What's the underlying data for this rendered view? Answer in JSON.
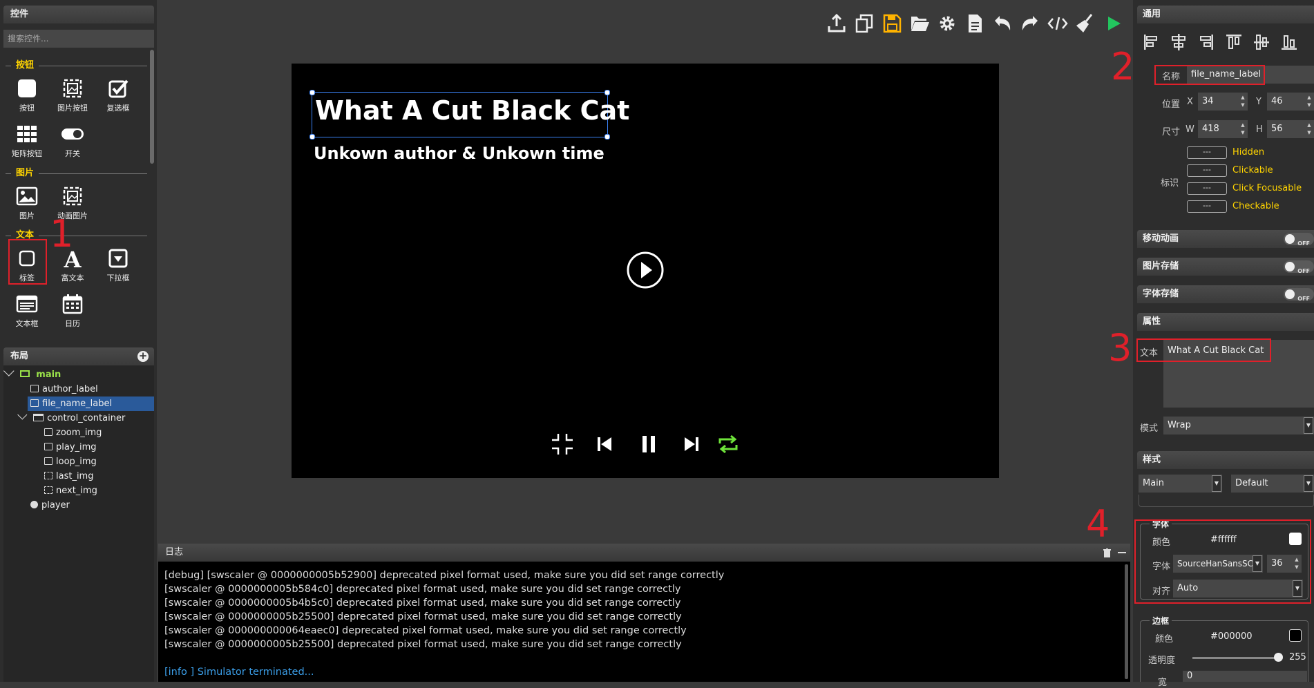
{
  "left_panel": {
    "title": "控件",
    "search_placeholder": "搜索控件...",
    "categories": {
      "button": "按钮",
      "image": "图片",
      "text": "文本"
    },
    "widgets": {
      "button": "按钮",
      "image_button": "图片按钮",
      "checkbox": "复选框",
      "matrix_button": "矩阵按钮",
      "switch": "开关",
      "image": "图片",
      "animated_image": "动画图片",
      "label": "标签",
      "rich_text": "富文本",
      "dropdown": "下拉框",
      "textarea": "文本框",
      "calendar": "日历"
    }
  },
  "layout_panel": {
    "title": "布局",
    "tree": {
      "main": "main",
      "author_label": "author_label",
      "file_name_label": "file_name_label",
      "control_container": "control_container",
      "zoom_img": "zoom_img",
      "play_img": "play_img",
      "loop_img": "loop_img",
      "last_img": "last_img",
      "next_img": "next_img",
      "player": "player"
    }
  },
  "canvas": {
    "title_text": "What A Cut Black Cat",
    "author_text": "Unkown author & Unkown time"
  },
  "log": {
    "title": "日志",
    "lines": [
      "[debug]  [swscaler @ 0000000005b52900] deprecated pixel format used, make sure you did set range correctly",
      "[swscaler @ 0000000005b584c0] deprecated pixel format used, make sure you did set range correctly",
      "[swscaler @ 0000000005b4b5c0] deprecated pixel format used, make sure you did set range correctly",
      "[swscaler @ 0000000005b25500] deprecated pixel format used, make sure you did set range correctly",
      "[swscaler @ 000000000064eaec0] deprecated pixel format used, make sure you did set range correctly",
      "[swscaler @ 0000000005b25500] deprecated pixel format used, make sure you did set range correctly"
    ],
    "info_line": "[info ] Simulator terminated..."
  },
  "right_panel": {
    "general_title": "通用",
    "name_label": "名称",
    "name_value": "file_name_label",
    "position_label": "位置",
    "x_label": "X",
    "x_value": "34",
    "y_label": "Y",
    "y_value": "46",
    "size_label": "尺寸",
    "w_label": "W",
    "w_value": "418",
    "h_label": "H",
    "h_value": "56",
    "flags_label": "标识",
    "flag_box": "---",
    "flags": [
      "Hidden",
      "Clickable",
      "Click Focusable",
      "Checkable"
    ],
    "move_anim": "移动动画",
    "image_store": "图片存储",
    "font_store": "字体存储",
    "off_text": "OFF",
    "attributes_title": "属性",
    "text_label": "文本",
    "text_value": "What A Cut Black Cat",
    "mode_label": "模式",
    "mode_value": "Wrap",
    "style_title": "样式",
    "style_main": "Main",
    "style_default": "Default",
    "font_group": "字体",
    "font_color_label": "颜色",
    "font_color_value": "#ffffff",
    "font_label": "字体",
    "font_value": "SourceHanSansSC",
    "font_size": "36",
    "align_label": "对齐",
    "align_value": "Auto",
    "border_group": "边框",
    "border_color_label": "颜色",
    "border_color_value": "#000000",
    "opacity_label": "透明度",
    "opacity_value": "255",
    "width_label": "宽",
    "width_value": "0"
  },
  "annotations": [
    "1",
    "2",
    "3",
    "4"
  ],
  "colors": {
    "accent_yellow": "#ffd400",
    "annotation_red": "#e0202a",
    "selection_blue": "#2a5a9a",
    "play_green": "#22c55e"
  }
}
